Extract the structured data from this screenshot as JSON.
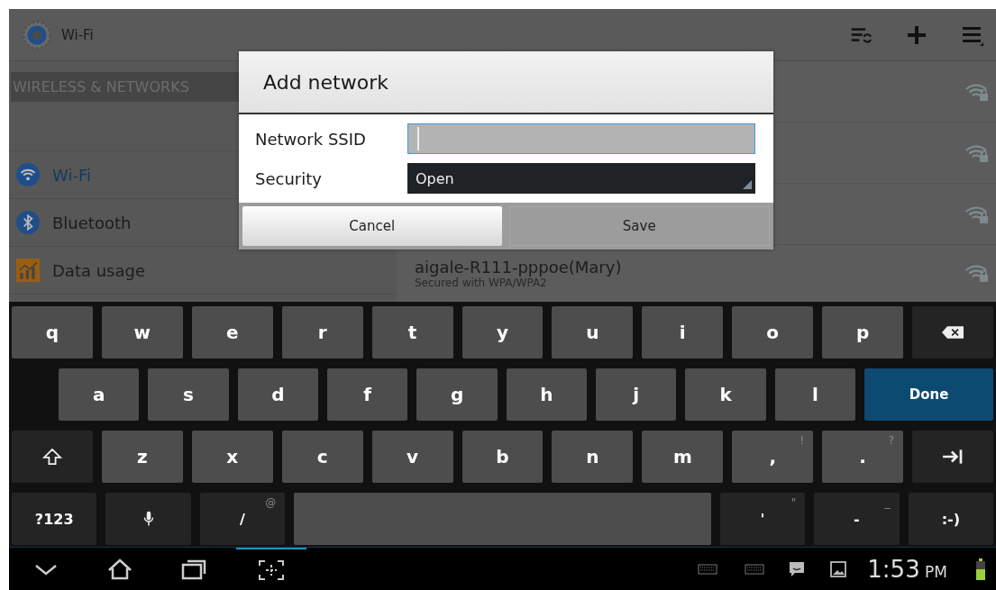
{
  "action_bar": {
    "title": "Wi-Fi"
  },
  "sidebar": {
    "header": "WIRELESS & NETWORKS",
    "items": [
      {
        "label": "Wi-Fi",
        "kind": "wifi",
        "selected": true
      },
      {
        "label": "Bluetooth",
        "kind": "bluetooth",
        "selected": false
      },
      {
        "label": "Data usage",
        "kind": "data",
        "selected": false
      }
    ]
  },
  "networks": [
    {
      "secured": true
    },
    {
      "secured": true
    },
    {
      "secured": true
    },
    {
      "name": "aigale-R111-pppoe(Mary)",
      "status": "Secured with WPA/WPA2",
      "secured": true
    }
  ],
  "dialog": {
    "title": "Add network",
    "fields": [
      {
        "label": "Network SSID",
        "kind": "text"
      },
      {
        "label": "Security",
        "kind": "select",
        "value": "Open"
      }
    ],
    "buttons": [
      {
        "label": "Cancel",
        "kind": "raised"
      },
      {
        "label": "Save",
        "kind": "flat"
      }
    ]
  },
  "keyboard": {
    "rows": [
      {
        "keys": [
          {
            "label": "q",
            "kind": "letter"
          },
          {
            "label": "w",
            "kind": "letter"
          },
          {
            "label": "e",
            "kind": "letter"
          },
          {
            "label": "r",
            "kind": "letter"
          },
          {
            "label": "t",
            "kind": "letter"
          },
          {
            "label": "y",
            "kind": "letter"
          },
          {
            "label": "u",
            "kind": "letter"
          },
          {
            "label": "i",
            "kind": "letter"
          },
          {
            "label": "o",
            "kind": "letter"
          },
          {
            "label": "p",
            "kind": "letter"
          },
          {
            "kind": "backspace"
          }
        ]
      },
      {
        "keys": [
          {
            "label": "a",
            "kind": "letter"
          },
          {
            "label": "s",
            "kind": "letter"
          },
          {
            "label": "d",
            "kind": "letter"
          },
          {
            "label": "f",
            "kind": "letter"
          },
          {
            "label": "g",
            "kind": "letter"
          },
          {
            "label": "h",
            "kind": "letter"
          },
          {
            "label": "j",
            "kind": "letter"
          },
          {
            "label": "k",
            "kind": "letter"
          },
          {
            "label": "l",
            "kind": "letter"
          },
          {
            "label": "Done",
            "kind": "done"
          }
        ]
      },
      {
        "keys": [
          {
            "kind": "shift"
          },
          {
            "label": "z",
            "kind": "letter"
          },
          {
            "label": "x",
            "kind": "letter"
          },
          {
            "label": "c",
            "kind": "letter"
          },
          {
            "label": "v",
            "kind": "letter"
          },
          {
            "label": "b",
            "kind": "letter"
          },
          {
            "label": "n",
            "kind": "letter"
          },
          {
            "label": "m",
            "kind": "letter"
          },
          {
            "label": ",",
            "hint": "!",
            "kind": "letter"
          },
          {
            "label": ".",
            "hint": "?",
            "kind": "letter"
          },
          {
            "kind": "tab"
          }
        ]
      },
      {
        "keys": [
          {
            "label": "?123",
            "kind": "func"
          },
          {
            "kind": "mic"
          },
          {
            "label": "/",
            "hint": "@",
            "kind": "func"
          },
          {
            "kind": "space"
          },
          {
            "label": "'",
            "hint": "\"",
            "kind": "func"
          },
          {
            "label": "-",
            "hint": "_",
            "kind": "func"
          },
          {
            "label": ":-)",
            "kind": "func"
          }
        ]
      }
    ]
  },
  "nav_bar": {
    "time": "1:53",
    "ampm": "PM"
  }
}
